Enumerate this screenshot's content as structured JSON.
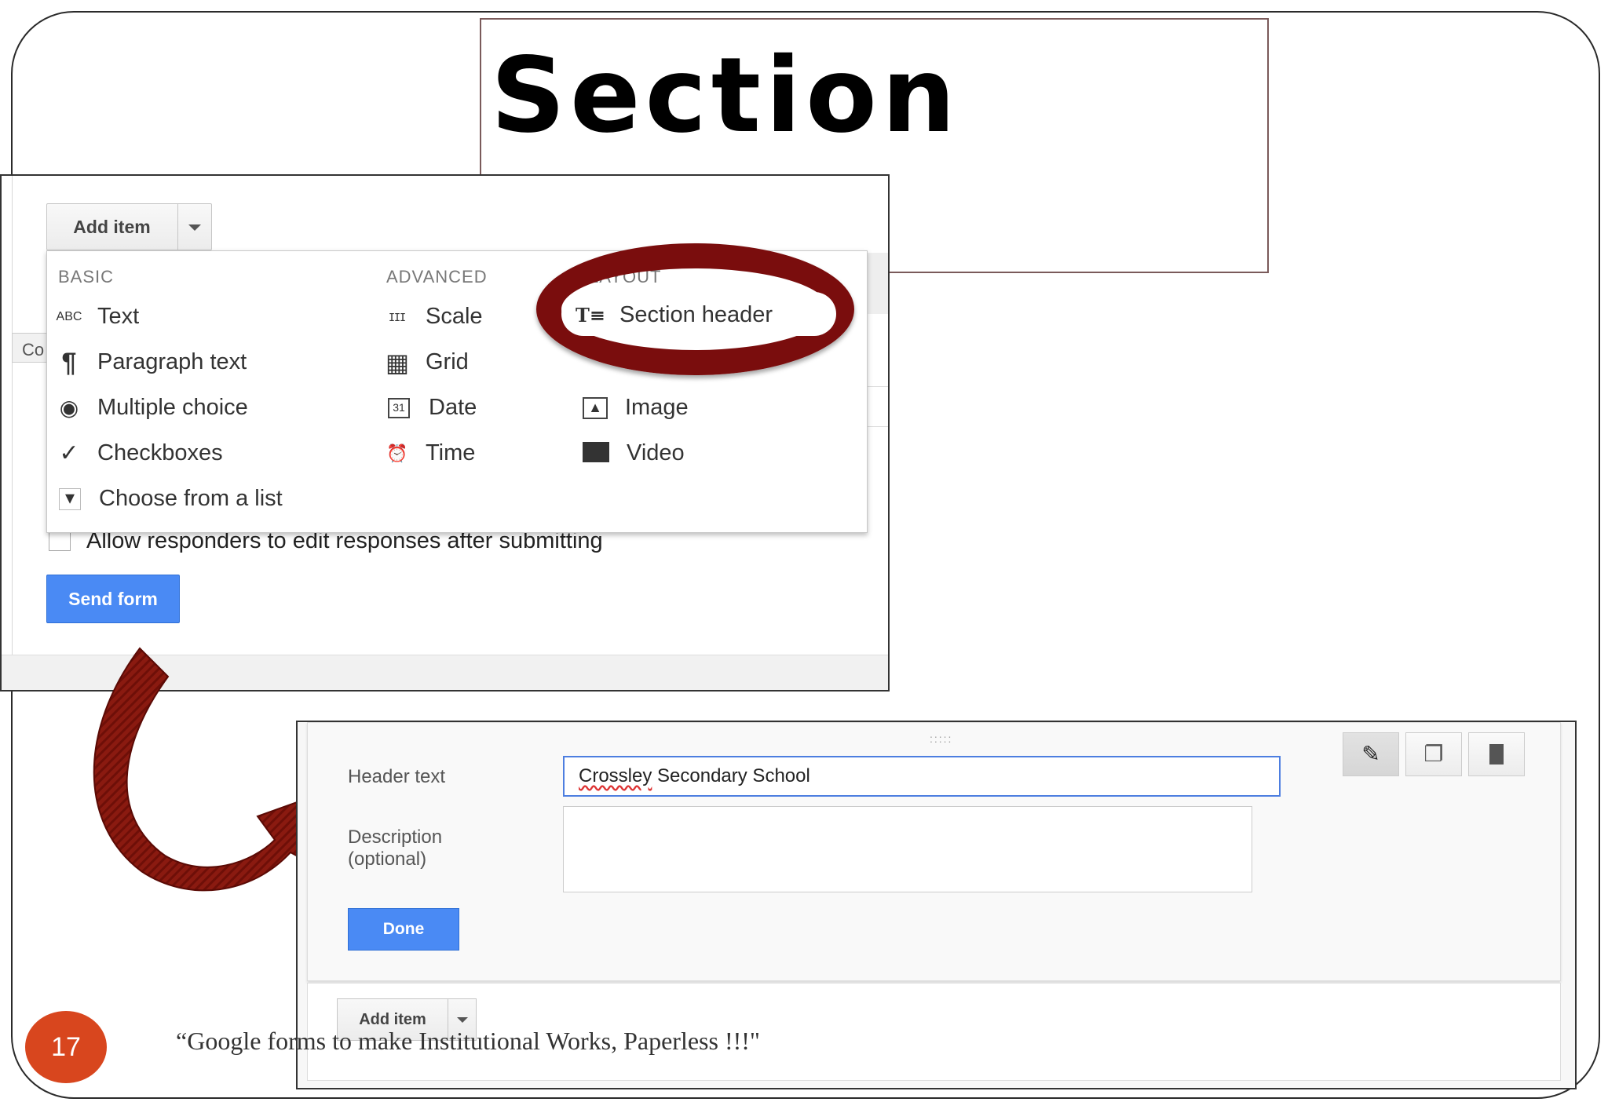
{
  "slide": {
    "title": "Section",
    "page_number": "17",
    "footer": "“Google forms to make Institutional Works, Paperless !!!\""
  },
  "top_screenshot": {
    "add_item_label": "Add item",
    "co_tab_label": "Co",
    "menu": {
      "basic_heading": "BASIC",
      "advanced_heading": "ADVANCED",
      "layout_heading": "LAYOUT",
      "basic_items": [
        {
          "icon": "abc-icon",
          "glyph": "ABC",
          "label": "Text"
        },
        {
          "icon": "paragraph-icon",
          "glyph": "¶",
          "label": "Paragraph text"
        },
        {
          "icon": "radio-icon",
          "glyph": "◉",
          "label": "Multiple choice"
        },
        {
          "icon": "checkbox-icon",
          "glyph": "✓",
          "label": "Checkboxes"
        },
        {
          "icon": "dropdown-icon",
          "glyph": "▾",
          "label": "Choose from a list"
        }
      ],
      "advanced_items": [
        {
          "icon": "scale-icon",
          "glyph": "ⵊⵊⵊ",
          "label": "Scale"
        },
        {
          "icon": "grid-icon",
          "glyph": "▦",
          "label": "Grid"
        },
        {
          "icon": "calendar-icon",
          "glyph": "31",
          "label": "Date"
        },
        {
          "icon": "clock-icon",
          "glyph": "⏰",
          "label": "Time"
        }
      ],
      "layout_items": [
        {
          "icon": "section-header-icon",
          "glyph": "T≡",
          "label": "Section header"
        },
        {
          "icon": "image-icon",
          "glyph": "▲",
          "label": "Image"
        },
        {
          "icon": "video-icon",
          "glyph": "🎬",
          "label": "Video"
        }
      ]
    },
    "allow_edit_label": "Allow responders to edit responses after submitting",
    "send_form_label": "Send form"
  },
  "bottom_screenshot": {
    "header_text_label": "Header text",
    "header_text_value_part1": "Crossley",
    "header_text_value_part2": " Secondary School",
    "description_label_line1": "Description",
    "description_label_line2": "(optional)",
    "description_value": "",
    "done_label": "Done",
    "add_item_label": "Add item",
    "drag_handle": ":::::",
    "tools": [
      {
        "icon": "pencil-icon",
        "glyph": "✎"
      },
      {
        "icon": "duplicate-icon",
        "glyph": "❐"
      },
      {
        "icon": "trash-icon",
        "glyph": "🗑"
      }
    ]
  },
  "colors": {
    "highlight": "#7a0d0d",
    "primary_button": "#4a8af4",
    "page_badge": "#d8461e"
  }
}
